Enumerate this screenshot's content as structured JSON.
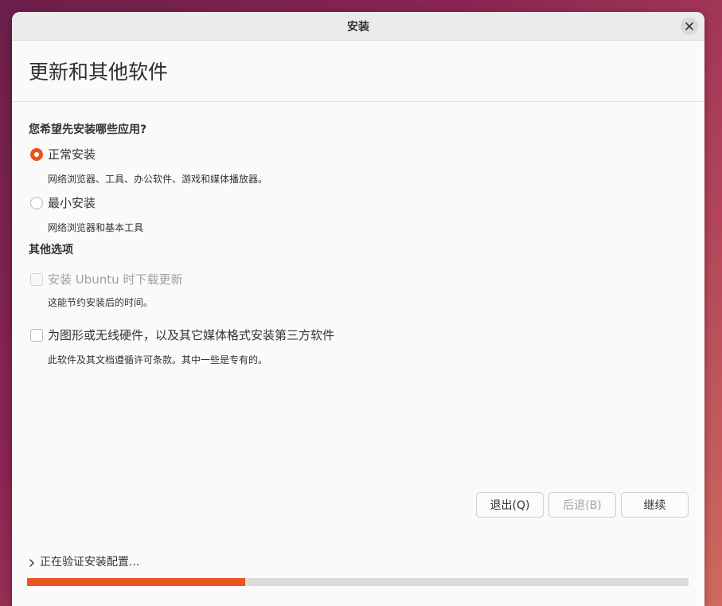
{
  "window": {
    "title": "安装"
  },
  "header": {
    "heading": "更新和其他软件"
  },
  "install_type": {
    "question": "您希望先安装哪些应用?",
    "options": [
      {
        "label": "正常安装",
        "desc": "网络浏览器、工具、办公软件、游戏和媒体播放器。",
        "checked": true
      },
      {
        "label": "最小安装",
        "desc": "网络浏览器和基本工具",
        "checked": false
      }
    ]
  },
  "other_options": {
    "title": "其他选项",
    "items": [
      {
        "label": "安装 Ubuntu 时下载更新",
        "desc": "这能节约安装后的时间。",
        "checked": false,
        "disabled": true
      },
      {
        "label": "为图形或无线硬件，以及其它媒体格式安装第三方软件",
        "desc": "此软件及其文档遵循许可条款。其中一些是专有的。",
        "checked": false,
        "disabled": false
      }
    ]
  },
  "buttons": {
    "quit": "退出(Q)",
    "back": "后退(B)",
    "continue": "继续"
  },
  "status": {
    "text": "正在验证安装配置...",
    "progress_percent": 33
  },
  "colors": {
    "accent": "#e95420",
    "window_bg": "#fafafa",
    "titlebar_bg": "#ebebeb"
  },
  "icons": {
    "close": "close-icon",
    "expander": "chevron-right-icon"
  }
}
